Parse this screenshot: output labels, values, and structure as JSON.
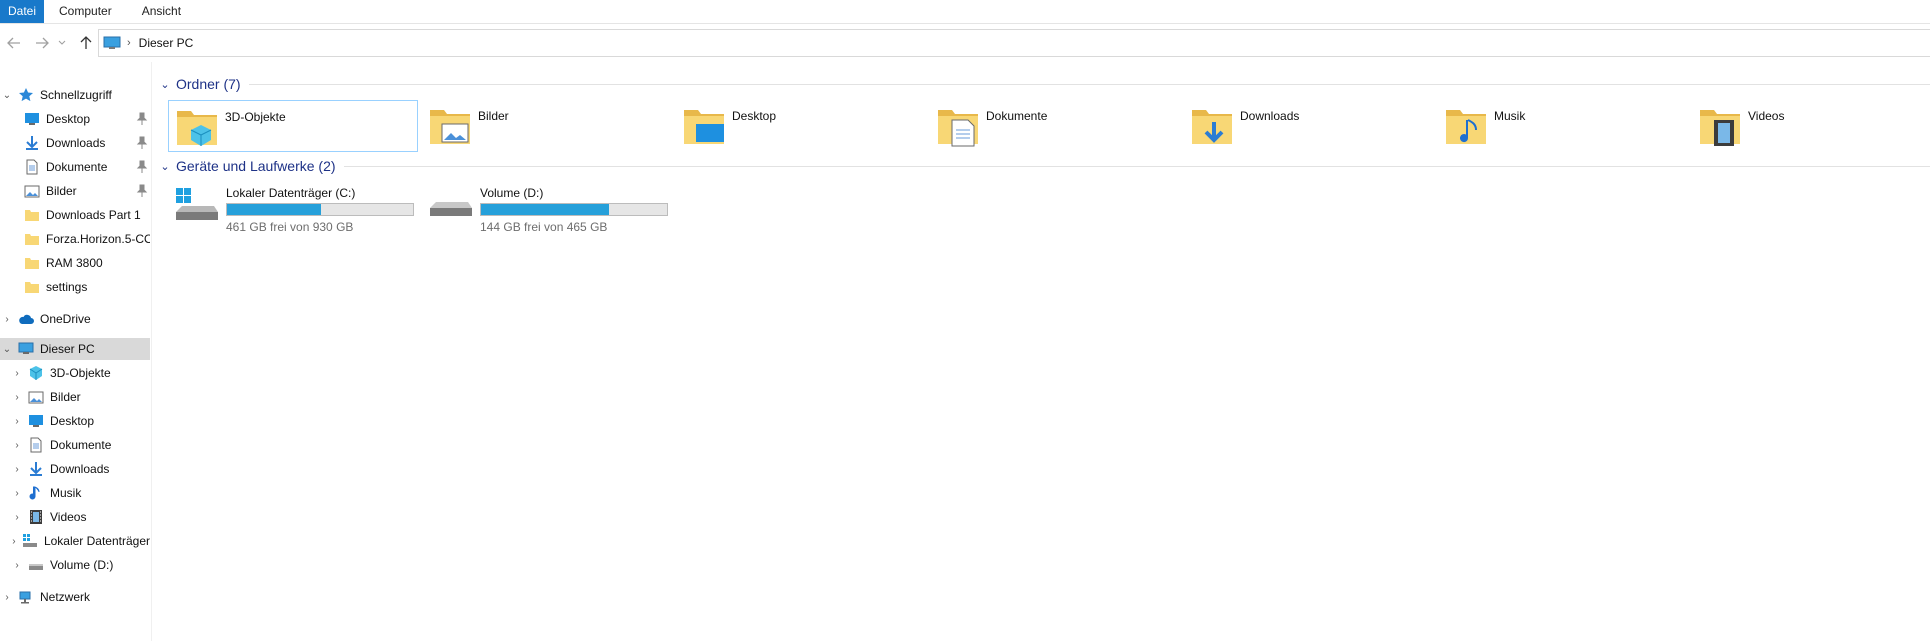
{
  "ribbon": {
    "tabs": [
      "Datei",
      "Computer",
      "Ansicht"
    ]
  },
  "address": {
    "path": "Dieser PC"
  },
  "sidebar": {
    "quick_access": {
      "label": "Schnellzugriff"
    },
    "quick_items": [
      {
        "label": "Desktop",
        "pinned": true
      },
      {
        "label": "Downloads",
        "pinned": true
      },
      {
        "label": "Dokumente",
        "pinned": true
      },
      {
        "label": "Bilder",
        "pinned": true
      },
      {
        "label": "Downloads Part 1",
        "pinned": false
      },
      {
        "label": "Forza.Horizon.5-CO",
        "pinned": false
      },
      {
        "label": "RAM 3800",
        "pinned": false
      },
      {
        "label": "settings",
        "pinned": false
      }
    ],
    "onedrive": {
      "label": "OneDrive"
    },
    "this_pc": {
      "label": "Dieser PC"
    },
    "pc_items": [
      {
        "label": "3D-Objekte",
        "icon": "3d-objects-icon"
      },
      {
        "label": "Bilder",
        "icon": "pictures-icon"
      },
      {
        "label": "Desktop",
        "icon": "desktop-icon"
      },
      {
        "label": "Dokumente",
        "icon": "documents-icon"
      },
      {
        "label": "Downloads",
        "icon": "downloads-icon"
      },
      {
        "label": "Musik",
        "icon": "music-icon"
      },
      {
        "label": "Videos",
        "icon": "videos-icon"
      },
      {
        "label": "Lokaler Datenträger",
        "icon": "system-drive-icon"
      },
      {
        "label": "Volume (D:)",
        "icon": "drive-icon"
      }
    ],
    "network": {
      "label": "Netzwerk"
    }
  },
  "main": {
    "folders_group": {
      "title": "Ordner (7)"
    },
    "folders": [
      {
        "name": "3D-Objekte",
        "icon": "3d-objects-folder-icon"
      },
      {
        "name": "Bilder",
        "icon": "pictures-folder-icon"
      },
      {
        "name": "Desktop",
        "icon": "desktop-folder-icon"
      },
      {
        "name": "Dokumente",
        "icon": "documents-folder-icon"
      },
      {
        "name": "Downloads",
        "icon": "downloads-folder-icon"
      },
      {
        "name": "Musik",
        "icon": "music-folder-icon"
      },
      {
        "name": "Videos",
        "icon": "videos-folder-icon"
      }
    ],
    "drives_group": {
      "title": "Geräte und Laufwerke (2)"
    },
    "drives": [
      {
        "name": "Lokaler Datenträger (C:)",
        "free_text": "461 GB frei von 930 GB",
        "used_fraction": 0.504
      },
      {
        "name": "Volume (D:)",
        "free_text": "144 GB frei von 465 GB",
        "used_fraction": 0.69
      }
    ]
  },
  "colors": {
    "accent": "#1979ca",
    "group_title": "#1e3287",
    "bar_fill": "#26a0da",
    "folder": "#f8d775"
  }
}
